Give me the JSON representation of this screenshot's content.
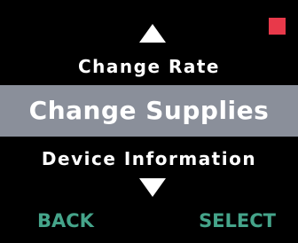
{
  "status": {
    "indicator_color": "#e8394a"
  },
  "menu": {
    "up_icon": "triangle-up-icon",
    "down_icon": "triangle-down-icon",
    "items": [
      {
        "label": "Change Rate"
      },
      {
        "label": "Change Supplies",
        "selected": true
      },
      {
        "label": "Device Information"
      }
    ],
    "selected_bg": "#8a8f9a",
    "text_color": "#ffffff"
  },
  "softkeys": {
    "left_label": "BACK",
    "right_label": "SELECT",
    "color": "#45a48a"
  }
}
